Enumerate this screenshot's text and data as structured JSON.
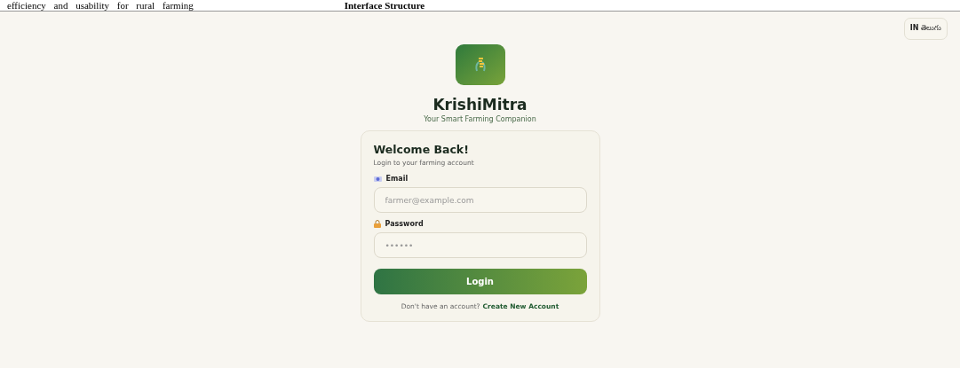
{
  "document_header": {
    "left_text": "efficiency and usability for rural farming",
    "right_text": "Interface Structure"
  },
  "language_button": {
    "flag": "IN",
    "label": "తెలుగు"
  },
  "brand": {
    "name": "KrishiMitra",
    "tagline": "Your Smart Farming Companion"
  },
  "login_card": {
    "title": "Welcome Back!",
    "subtitle": "Login to your farming account",
    "fields": [
      {
        "kind": "email",
        "label": "Email",
        "placeholder": "farmer@example.com"
      },
      {
        "kind": "password",
        "label": "Password",
        "placeholder": "••••••"
      }
    ],
    "submit_button": "Login",
    "signup_prompt": "Don't have an account?",
    "signup_link": "Create New Account"
  }
}
